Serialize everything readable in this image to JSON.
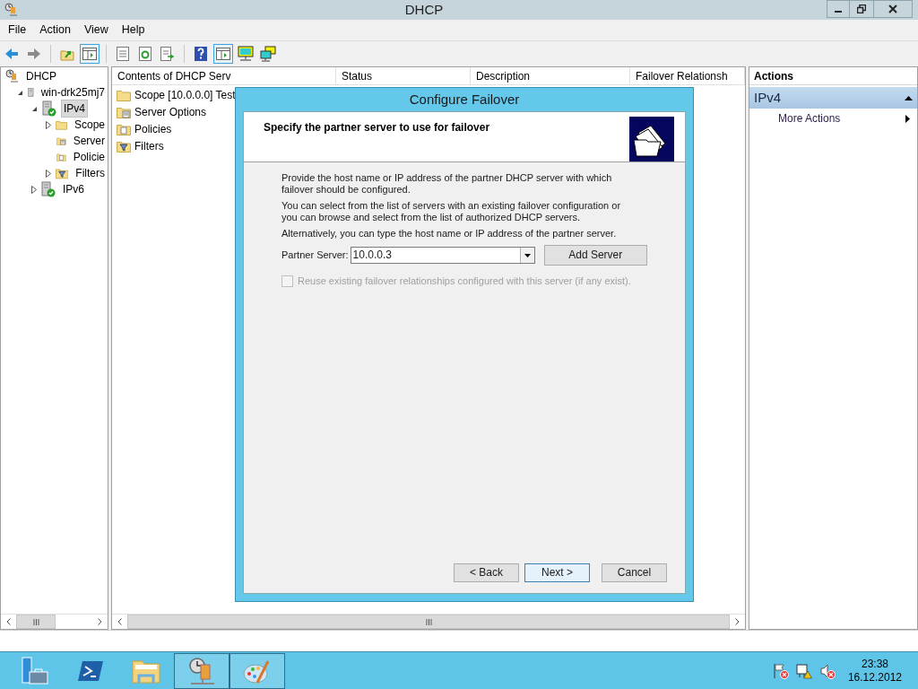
{
  "window": {
    "title": "DHCP"
  },
  "menu": [
    "File",
    "Action",
    "View",
    "Help"
  ],
  "toolbar": [
    {
      "kind": "back",
      "disabled": false
    },
    {
      "kind": "forward",
      "disabled": true
    },
    {
      "kind": "sep"
    },
    {
      "kind": "up",
      "selected": false
    },
    {
      "kind": "pane",
      "selected": true
    },
    {
      "kind": "sep"
    },
    {
      "kind": "list",
      "selected": false
    },
    {
      "kind": "refresh",
      "selected": false
    },
    {
      "kind": "export",
      "selected": false
    },
    {
      "kind": "sep"
    },
    {
      "kind": "help",
      "selected": false
    },
    {
      "kind": "pane",
      "selected": true
    },
    {
      "kind": "monitor",
      "selected": false
    },
    {
      "kind": "monitors",
      "selected": false
    }
  ],
  "tree": [
    {
      "label": "DHCP",
      "kind": "dhcp",
      "selected": false,
      "children": [
        {
          "label": "win-drk25mj7",
          "kind": "server",
          "expanded": true,
          "selected": false,
          "children": [
            {
              "label": "IPv4",
              "kind": "ip",
              "expanded": true,
              "selected": true,
              "children": [
                {
                  "label": "Scope",
                  "kind": "folder",
                  "expanded": false,
                  "selected": false
                },
                {
                  "label": "Server",
                  "kind": "options",
                  "selected": false
                },
                {
                  "label": "Policie",
                  "kind": "policies",
                  "selected": false
                },
                {
                  "label": "Filters",
                  "kind": "filters",
                  "expanded": false,
                  "selected": false
                }
              ]
            },
            {
              "label": "IPv6",
              "kind": "ip",
              "expanded": false,
              "selected": false
            }
          ]
        }
      ]
    }
  ],
  "contents": {
    "columns": [
      "Contents of DHCP Serv",
      "Status",
      "Description",
      "Failover Relationsh"
    ],
    "rows": [
      {
        "label": "Scope [10.0.0.0] Test",
        "kind": "folder"
      },
      {
        "label": "Server Options",
        "kind": "options"
      },
      {
        "label": "Policies",
        "kind": "policies"
      },
      {
        "label": "Filters",
        "kind": "filters"
      }
    ]
  },
  "actions": {
    "title": "Actions",
    "section": {
      "label": "IPv4",
      "expanded": true
    },
    "items": [
      "More Actions"
    ]
  },
  "dialog": {
    "title": "Configure Failover",
    "heading": "Specify the partner server to use for failover",
    "paragraphs": [
      "Provide the host name or IP address of the partner DHCP server with which failover should be configured.",
      "You can select from the list of servers with an existing failover configuration or you can browse and select from the list of authorized DHCP servers.",
      "Alternatively, you can type the host name or IP address of the partner server."
    ],
    "partner_label": "Partner Server:",
    "partner_value": "10.0.0.3",
    "add_button": "Add Server",
    "checkbox": {
      "label": "Reuse existing failover relationships configured with this server (if any exist).",
      "checked": false,
      "disabled": true
    },
    "buttons": [
      {
        "label": "< Back",
        "default": false
      },
      {
        "label": "Next >",
        "default": true
      },
      {
        "label": "Cancel",
        "default": false
      }
    ]
  },
  "taskbar": {
    "apps": [
      {
        "kind": "server-manager",
        "active": false
      },
      {
        "kind": "powershell",
        "active": false
      },
      {
        "kind": "explorer",
        "active": false
      },
      {
        "kind": "dhcp",
        "active": true
      },
      {
        "kind": "paint",
        "active": true
      }
    ],
    "tray": [
      {
        "kind": "flag"
      },
      {
        "kind": "network"
      },
      {
        "kind": "speaker"
      }
    ],
    "time": "23:38",
    "date": "16.12.2012"
  }
}
